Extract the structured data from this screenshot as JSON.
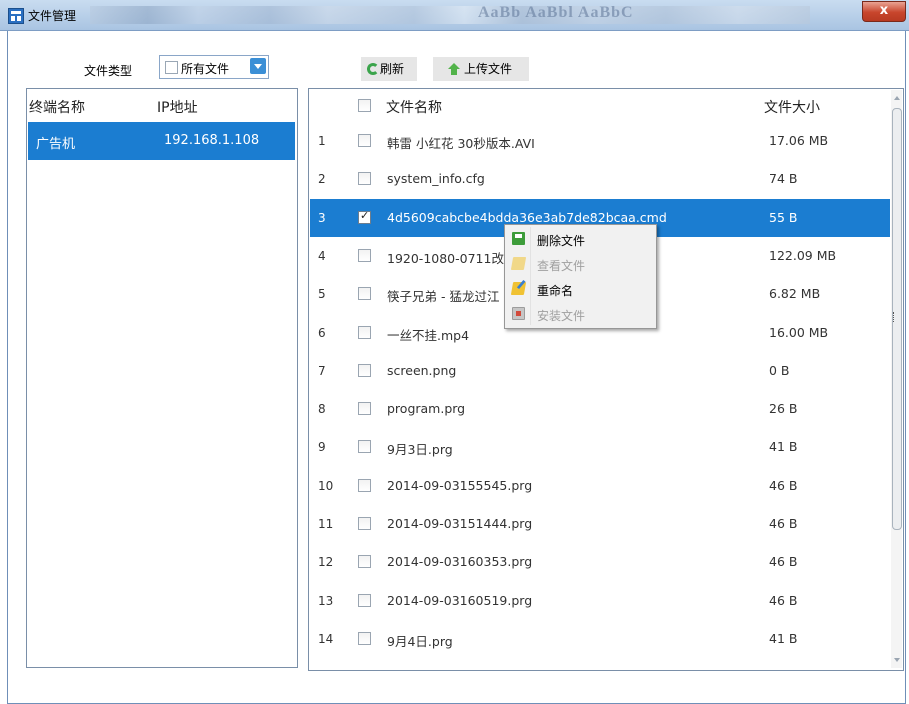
{
  "window": {
    "title": "文件管理",
    "close_label": "x",
    "blurred_toolbar_text": "AaBb AaBbl AaBbC"
  },
  "filter": {
    "label": "文件类型",
    "selected": "所有文件"
  },
  "toolbar": {
    "refresh_label": "刷新",
    "upload_label": "上传文件"
  },
  "terminals": {
    "headers": [
      "终端名称",
      "IP地址"
    ],
    "rows": [
      {
        "name": "广告机",
        "ip": "192.168.1.108",
        "selected": true
      }
    ]
  },
  "files": {
    "headers": {
      "name": "文件名称",
      "size": "文件大小"
    },
    "rows": [
      {
        "index": "1",
        "name": "韩雷 小红花 30秒版本.AVI",
        "size": "17.06 MB",
        "checked": false
      },
      {
        "index": "2",
        "name": "system_info.cfg",
        "size": "74 B",
        "checked": false
      },
      {
        "index": "3",
        "name": "4d5609cabcbe4bdda36e3ab7de82bcaa.cmd",
        "size": "55 B",
        "checked": true,
        "selected": true
      },
      {
        "index": "4",
        "name": "1920-1080-0711改",
        "size": "122.09 MB",
        "checked": false
      },
      {
        "index": "5",
        "name": "筷子兄弟 - 猛龙过江",
        "size": "6.82 MB",
        "checked": false
      },
      {
        "index": "6",
        "name": "一丝不挂.mp4",
        "size": "16.00 MB",
        "checked": false
      },
      {
        "index": "7",
        "name": "screen.png",
        "size": "0 B",
        "checked": false
      },
      {
        "index": "8",
        "name": "program.prg",
        "size": "26 B",
        "checked": false
      },
      {
        "index": "9",
        "name": "9月3日.prg",
        "size": "41 B",
        "checked": false
      },
      {
        "index": "10",
        "name": "2014-09-03155545.prg",
        "size": "46 B",
        "checked": false
      },
      {
        "index": "11",
        "name": "2014-09-03151444.prg",
        "size": "46 B",
        "checked": false
      },
      {
        "index": "12",
        "name": "2014-09-03160353.prg",
        "size": "46 B",
        "checked": false
      },
      {
        "index": "13",
        "name": "2014-09-03160519.prg",
        "size": "46 B",
        "checked": false
      },
      {
        "index": "14",
        "name": "9月4日.prg",
        "size": "41 B",
        "checked": false
      }
    ]
  },
  "context_menu": {
    "items": [
      {
        "label": "删除文件",
        "enabled": true,
        "icon": "save-delete-icon"
      },
      {
        "label": "查看文件",
        "enabled": false,
        "icon": "view-note-icon"
      },
      {
        "label": "重命名",
        "enabled": true,
        "icon": "rename-pencil-icon"
      },
      {
        "label": "安装文件",
        "enabled": false,
        "icon": "install-icon"
      }
    ]
  },
  "colors": {
    "selection": "#1b7dd1",
    "titlebar": "#b6cde8",
    "close_button": "#c8452c"
  }
}
